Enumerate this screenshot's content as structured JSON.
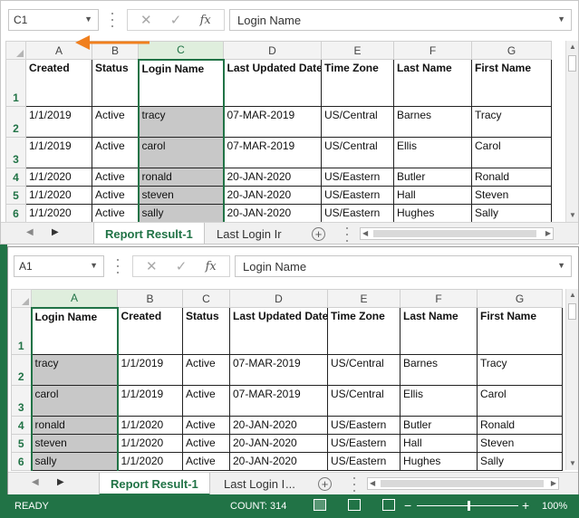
{
  "top": {
    "name_box": "C1",
    "formula": "Login Name",
    "fx_label": "fx",
    "columns": [
      "A",
      "B",
      "C",
      "D",
      "E",
      "F",
      "G"
    ],
    "row_numbers": [
      "1",
      "2",
      "3",
      "4",
      "5",
      "6"
    ],
    "headers": [
      "Created",
      "Status",
      "Login Name",
      "Last Updated Date",
      "Time Zone",
      "Last Name",
      "First Name"
    ],
    "rows": [
      [
        "1/1/2019",
        "Active",
        "tracy",
        "07-MAR-2019",
        "US/Central",
        "Barnes",
        "Tracy"
      ],
      [
        "1/1/2019",
        "Active",
        "carol",
        "07-MAR-2019",
        "US/Central",
        "Ellis",
        "Carol"
      ],
      [
        "1/1/2020",
        "Active",
        "ronald",
        "20-JAN-2020",
        "US/Eastern",
        "Butler",
        "Ronald"
      ],
      [
        "1/1/2020",
        "Active",
        "steven",
        "20-JAN-2020",
        "US/Eastern",
        "Hall",
        "Steven"
      ],
      [
        "1/1/2020",
        "Active",
        "sally",
        "20-JAN-2020",
        "US/Eastern",
        "Hughes",
        "Sally"
      ]
    ],
    "tabs": [
      "Report Result-1",
      "Last Login Ir"
    ]
  },
  "bottom": {
    "name_box": "A1",
    "formula": "Login Name",
    "fx_label": "fx",
    "columns": [
      "A",
      "B",
      "C",
      "D",
      "E",
      "F",
      "G"
    ],
    "row_numbers": [
      "1",
      "2",
      "3",
      "4",
      "5",
      "6"
    ],
    "headers": [
      "Login Name",
      "Created",
      "Status",
      "Last Updated Date",
      "Time Zone",
      "Last Name",
      "First Name"
    ],
    "rows": [
      [
        "tracy",
        "1/1/2019",
        "Active",
        "07-MAR-2019",
        "US/Central",
        "Barnes",
        "Tracy"
      ],
      [
        "carol",
        "1/1/2019",
        "Active",
        "07-MAR-2019",
        "US/Central",
        "Ellis",
        "Carol"
      ],
      [
        "ronald",
        "1/1/2020",
        "Active",
        "20-JAN-2020",
        "US/Eastern",
        "Butler",
        "Ronald"
      ],
      [
        "steven",
        "1/1/2020",
        "Active",
        "20-JAN-2020",
        "US/Eastern",
        "Hall",
        "Steven"
      ],
      [
        "sally",
        "1/1/2020",
        "Active",
        "20-JAN-2020",
        "US/Eastern",
        "Hughes",
        "Sally"
      ]
    ],
    "tabs": [
      "Report Result-1",
      "Last Login Ir"
    ],
    "tab_more": "...",
    "status": {
      "ready": "READY",
      "count": "COUNT: 314",
      "zoom": "100%",
      "zoom_minus": "−",
      "zoom_plus": "+"
    }
  },
  "icons": {
    "cancel": "close-icon",
    "enter": "check-icon",
    "arrow": "arrow-left-icon"
  },
  "colors": {
    "excel_green": "#217346",
    "selected_gray": "#c8c8c8",
    "arrow_orange": "#f07f1e"
  }
}
